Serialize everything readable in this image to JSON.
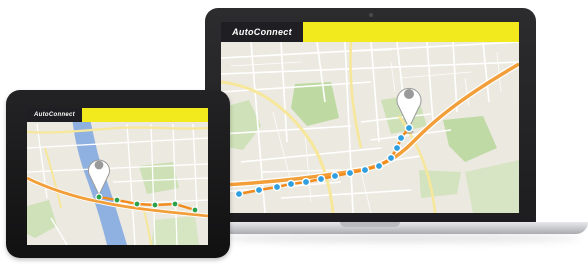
{
  "laptop": {
    "brand": "AutoConnect",
    "colors": {
      "header_bar": "#f3ea1e",
      "brand_tile": "#1f1f23",
      "route": "#f28b1c",
      "route_marker": "#2f9fe0",
      "pin": "#ffffff"
    }
  },
  "tablet": {
    "brand": "AutoConnect",
    "colors": {
      "header_bar": "#f3ea1e",
      "brand_tile": "#1f1f23",
      "route": "#f28b1c",
      "route_marker": "#2aa24a",
      "pin": "#ffffff"
    }
  }
}
